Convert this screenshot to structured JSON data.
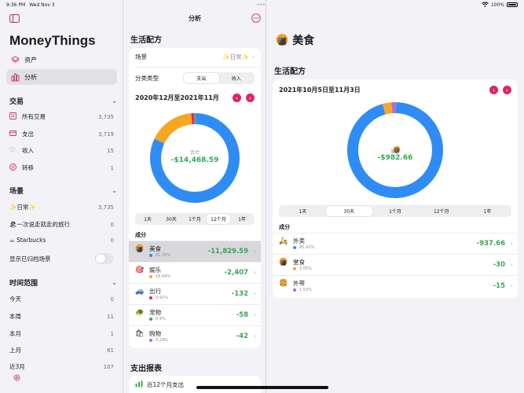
{
  "status": {
    "time": "9:36 PM",
    "date": "Wed Nov 3",
    "battery": "100%"
  },
  "colors": {
    "accent": "#e0245e",
    "green": "#34a853",
    "blue": "#2f8cf5",
    "orange": "#f5a623",
    "purple": "#b36bd6"
  },
  "sidebar": {
    "app_title": "MoneyThings",
    "top_items": [
      {
        "label": "资产",
        "icon": "layers-icon"
      },
      {
        "label": "分析",
        "icon": "bar-chart-icon"
      }
    ],
    "sections": [
      {
        "title": "交易",
        "items": [
          {
            "label": "所有交易",
            "count": "3,735"
          },
          {
            "label": "支出",
            "count": "3,719"
          },
          {
            "label": "收入",
            "count": "15"
          },
          {
            "label": "转移",
            "count": "1"
          }
        ]
      },
      {
        "title": "场景",
        "items": [
          {
            "label": "✨日常✨",
            "count": "3,735"
          },
          {
            "label": "🏖一次说走就走的旅行",
            "count": "0"
          },
          {
            "label": "☕ Starbucks",
            "count": "0"
          }
        ],
        "toggle_label": "显示已归档场景"
      },
      {
        "title": "时间范围",
        "items": [
          {
            "label": "今天",
            "count": "0"
          },
          {
            "label": "本周",
            "count": "11"
          },
          {
            "label": "本月",
            "count": "1"
          },
          {
            "label": "上月",
            "count": "61"
          },
          {
            "label": "近3月",
            "count": "107"
          }
        ]
      }
    ]
  },
  "mid": {
    "title": "分析",
    "section_title": "生活配方",
    "scene_label": "场景",
    "scene_value": "✨日常✨",
    "class_label": "分类类型",
    "class_options": [
      "支出",
      "收入"
    ],
    "period": "2020年12月至2021年11月",
    "donut_label": "合计",
    "donut_value": "-$14,468.59",
    "range_options": [
      "1天",
      "30天",
      "1个月",
      "12个月",
      "1年"
    ],
    "range_selected": 3,
    "comp_title": "成分",
    "components": [
      {
        "icon": "🍘",
        "name": "美食",
        "pct": "81.76%",
        "amount": "-11,829.59",
        "dot": "#2f8cf5",
        "value": 81.76
      },
      {
        "icon": "🎯",
        "name": "娱乐",
        "pct": "16.64%",
        "amount": "-2,407",
        "dot": "#f5a623",
        "value": 16.64
      },
      {
        "icon": "🚙",
        "name": "出行",
        "pct": "0.91%",
        "amount": "-132",
        "dot": "#e0245e",
        "value": 0.91
      },
      {
        "icon": "🐢",
        "name": "宠物",
        "pct": "0.4%",
        "amount": "-58",
        "dot": "#34a853",
        "value": 0.4
      },
      {
        "icon": "🛍",
        "name": "购物",
        "pct": "0.29%",
        "amount": "-42",
        "dot": "#b36bd6",
        "value": 0.29
      }
    ],
    "report_title": "支出报表",
    "report_item": "近12个月支出"
  },
  "detail": {
    "title": "美食",
    "section_title": "生活配方",
    "period": "2021年10月5日至11月3日",
    "donut_label": "美食",
    "donut_value": "-$982.66",
    "range_options": [
      "1天",
      "30天",
      "1个月",
      "12个月",
      "1年"
    ],
    "range_selected": 1,
    "comp_title": "成分",
    "components": [
      {
        "icon": "🛵",
        "name": "外卖",
        "pct": "95.42%",
        "amount": "-937.66",
        "dot": "#2f8cf5",
        "value": 95.42
      },
      {
        "icon": "🍘",
        "name": "堂食",
        "pct": "3.05%",
        "amount": "-30",
        "dot": "#f5a623",
        "value": 3.05
      },
      {
        "icon": "🍔",
        "name": "外带",
        "pct": "1.53%",
        "amount": "-15",
        "dot": "#b36bd6",
        "value": 1.53
      }
    ]
  }
}
